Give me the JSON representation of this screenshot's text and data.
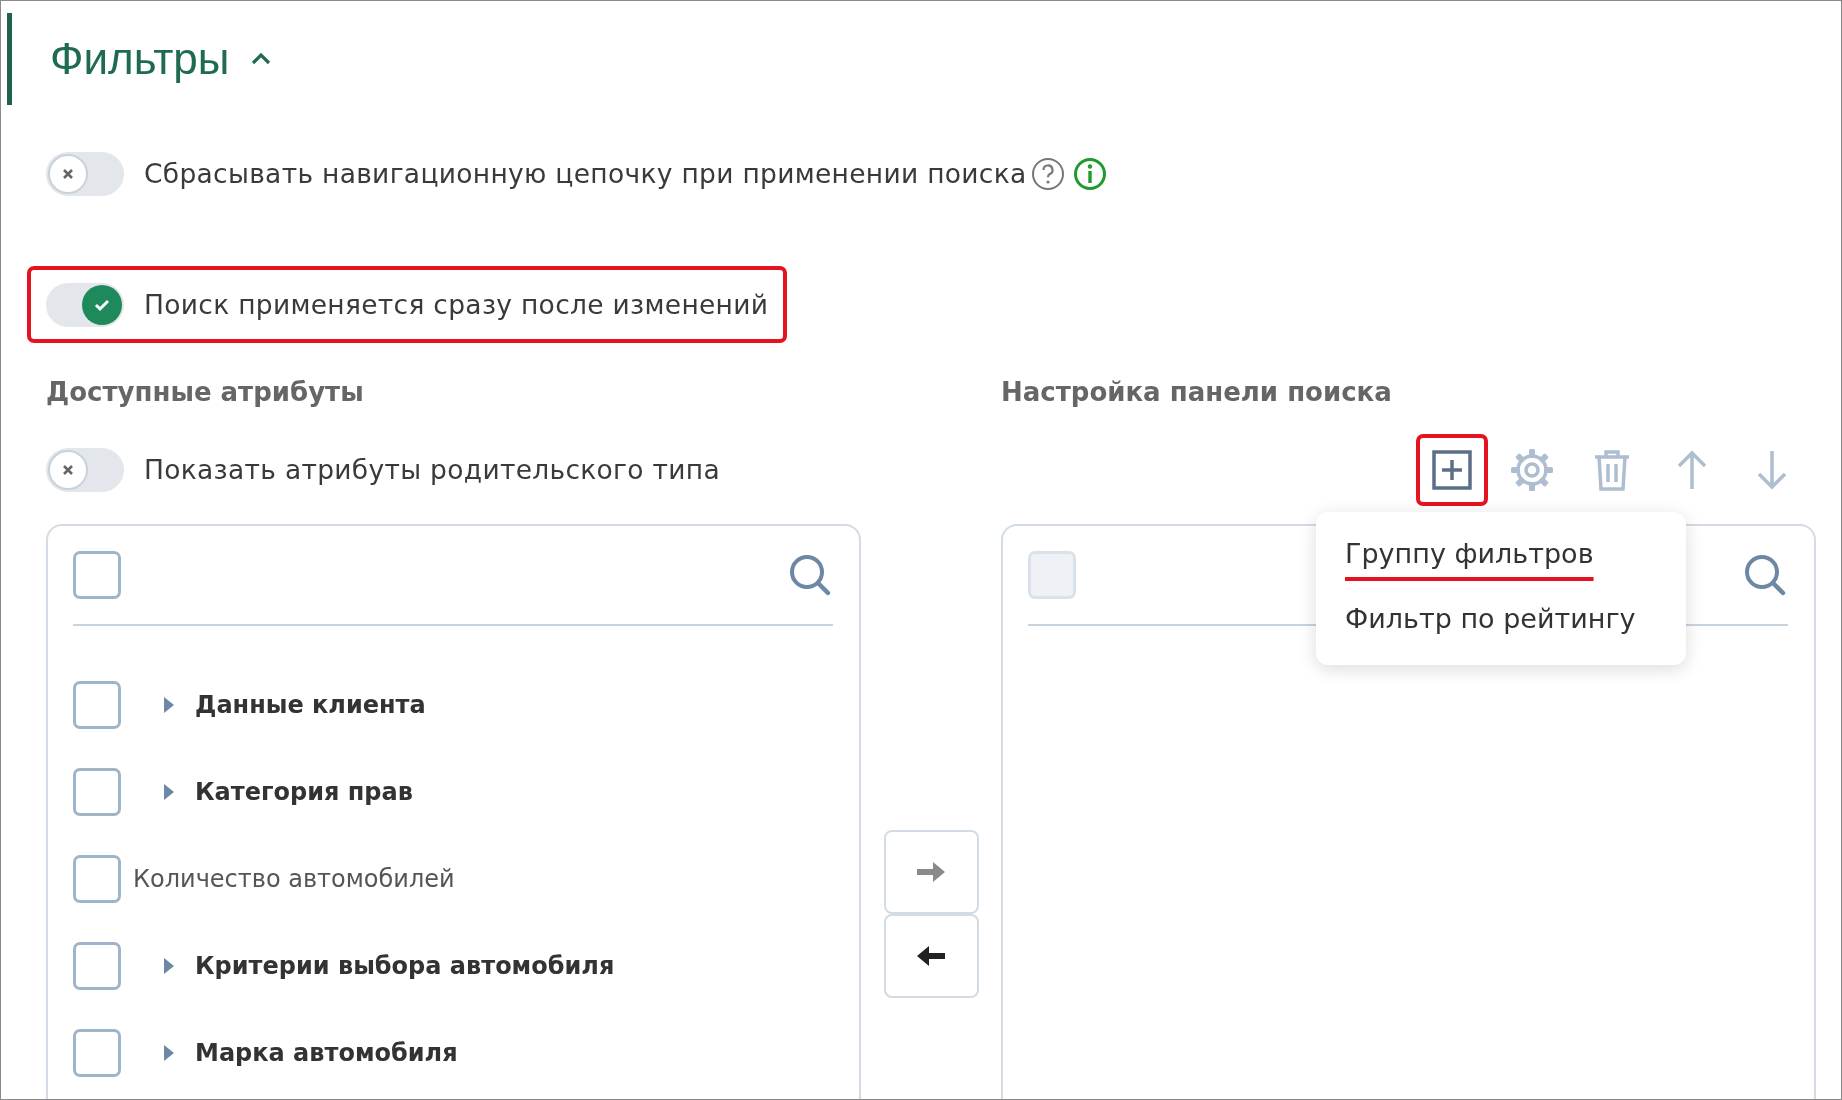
{
  "header": {
    "title": "Фильтры",
    "expanded": true
  },
  "toggles": [
    {
      "label": "Сбрасывать навигационную цепочку при применении поиска",
      "on": false,
      "kind": "with-help",
      "highlighted": false
    },
    {
      "label": "Поиск применяется сразу после изменений",
      "on": true,
      "kind": "plain",
      "highlighted": true
    }
  ],
  "available": {
    "title": "Доступные атрибуты",
    "toggle": {
      "label": "Показать атрибуты родительского типа",
      "on": false
    },
    "select_all": {
      "checked": false,
      "disabled": false
    },
    "items": [
      {
        "label": "Данные клиента",
        "kind": "group",
        "checked": false
      },
      {
        "label": "Категория прав",
        "kind": "group",
        "checked": false
      },
      {
        "label": "Количество автомобилей",
        "kind": "attribute",
        "checked": false
      },
      {
        "label": "Критерии выбора автомобиля",
        "kind": "group",
        "checked": false
      },
      {
        "label": "Марка автомобиля",
        "kind": "group",
        "checked": false
      }
    ]
  },
  "transfer": [
    {
      "kind": "to-right",
      "disabled": true
    },
    {
      "kind": "to-left",
      "disabled": false
    }
  ],
  "search_panel": {
    "title": "Настройка панели поиска",
    "toolbar": [
      {
        "kind": "add",
        "disabled": false,
        "highlighted": true
      },
      {
        "kind": "settings",
        "disabled": true,
        "highlighted": false
      },
      {
        "kind": "delete",
        "disabled": true,
        "highlighted": false
      },
      {
        "kind": "up",
        "disabled": true,
        "highlighted": false
      },
      {
        "kind": "down",
        "disabled": true,
        "highlighted": false
      }
    ],
    "select_all": {
      "checked": false,
      "disabled": true
    },
    "menu": {
      "items": [
        {
          "label": "Группу фильтров",
          "highlighted": true
        },
        {
          "label": "Фильтр по рейтингу",
          "highlighted": false
        }
      ]
    }
  }
}
